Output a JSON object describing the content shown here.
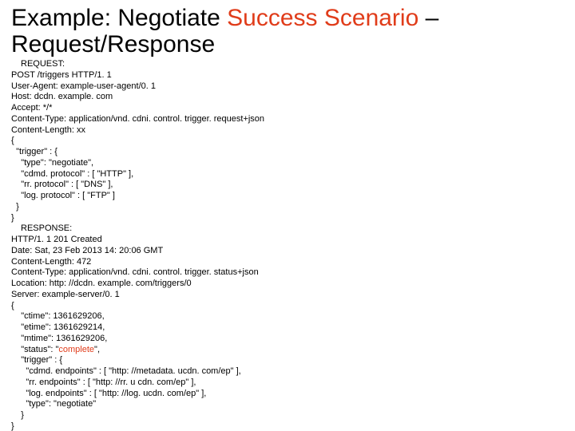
{
  "title": {
    "pre": "Example: Negotiate ",
    "accent": "Success Scenario",
    "post": " – Request/Response"
  },
  "request": {
    "label": "REQUEST:",
    "lines": [
      "POST /triggers HTTP/1. 1",
      "User-Agent: example-user-agent/0. 1",
      "Host: dcdn. example. com",
      "Accept: */*",
      "Content-Type: application/vnd. cdni. control. trigger. request+json",
      "Content-Length: xx",
      "{",
      "  \"trigger\" : {",
      "    \"type\": \"negotiate\",",
      "    \"cdmd. protocol\" : [ \"HTTP\" ],",
      "    \"rr. protocol\" : [ \"DNS\" ],",
      "    \"log. protocol\" : [ \"FTP\" ]",
      "  }",
      "}"
    ]
  },
  "response": {
    "label": "RESPONSE:",
    "lines_before": [
      "HTTP/1. 1 201 Created",
      "Date: Sat, 23 Feb 2013 14: 20:06 GMT",
      "Content-Length: 472",
      "Content-Type: application/vnd. cdni. control. trigger. status+json",
      "Location: http: //dcdn. example. com/triggers/0",
      "Server: example-server/0. 1",
      "{",
      "    \"ctime\": 1361629206,",
      "    \"etime\": 1361629214,",
      "    \"mtime\": 1361629206,"
    ],
    "status_line_pre": "    \"status\": \"",
    "status_line_accent": "complete",
    "status_line_post": "\",",
    "lines_after": [
      "    \"trigger\" : {",
      "      \"cdmd. endpoints\" : [ \"http: //metadata. ucdn. com/ep\" ],",
      "      \"rr. endpoints\" : [ \"http: //rr. u cdn. com/ep\" ],",
      "      \"log. endpoints\" : [ \"http: //log. ucdn. com/ep\" ],",
      "      \"type\": \"negotiate\"",
      "    }",
      "}"
    ]
  }
}
